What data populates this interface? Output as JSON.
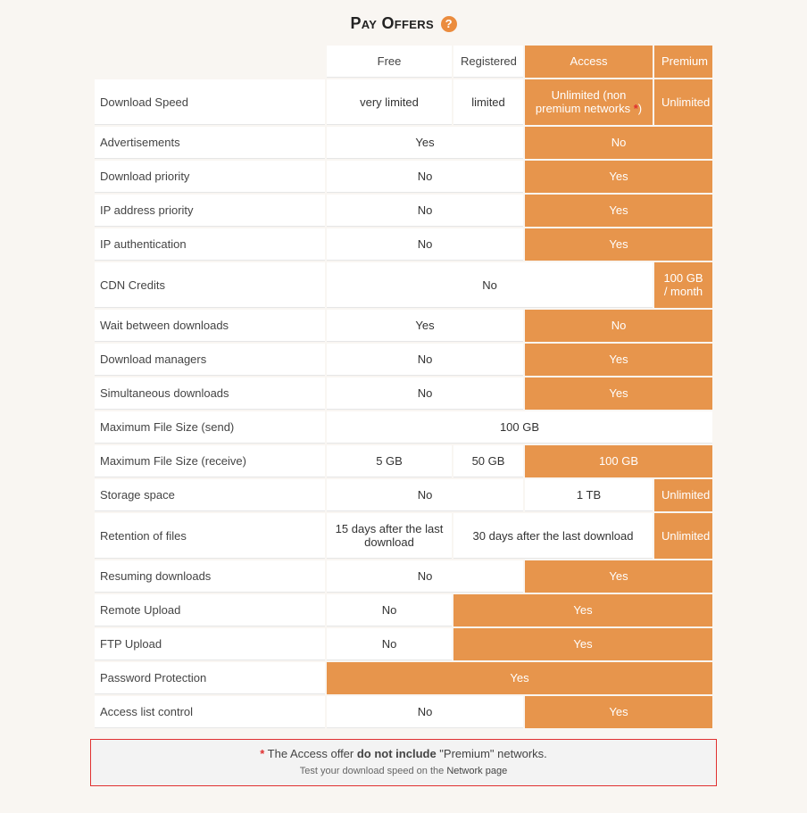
{
  "title": "Pay Offers",
  "help_badge": "?",
  "plans": {
    "free": "Free",
    "registered": "Registered",
    "access": "Access",
    "premium": "Premium"
  },
  "rows": {
    "download_speed": {
      "label": "Download Speed",
      "free": "very limited",
      "registered": "limited",
      "access_prefix": "Unlimited (non premium networks ",
      "access_ast": "*",
      "access_suffix": ")",
      "premium": "Unlimited"
    },
    "ads": {
      "label": "Advertisements",
      "free_reg": "Yes",
      "acc_prem": "No"
    },
    "dlprio": {
      "label": "Download priority",
      "free_reg": "No",
      "acc_prem": "Yes"
    },
    "ipprio": {
      "label": "IP address priority",
      "free_reg": "No",
      "acc_prem": "Yes"
    },
    "ipauth": {
      "label": "IP authentication",
      "free_reg": "No",
      "acc_prem": "Yes"
    },
    "cdn": {
      "label": "CDN Credits",
      "free_reg_acc": "No",
      "premium": "100 GB / month"
    },
    "wait": {
      "label": "Wait between downloads",
      "free_reg": "Yes",
      "acc_prem": "No"
    },
    "dlmgr": {
      "label": "Download managers",
      "free_reg": "No",
      "acc_prem": "Yes"
    },
    "simul": {
      "label": "Simultaneous downloads",
      "free_reg": "No",
      "acc_prem": "Yes"
    },
    "maxsend": {
      "label": "Maximum File Size (send)",
      "all": "100 GB"
    },
    "maxrecv": {
      "label": "Maximum File Size (receive)",
      "free": "5 GB",
      "registered": "50 GB",
      "acc_prem": "100 GB"
    },
    "storage": {
      "label": "Storage space",
      "free_reg": "No",
      "access": "1 TB",
      "premium": "Unlimited"
    },
    "retention": {
      "label": "Retention of files",
      "free": "15 days after the last download",
      "reg_acc": "30 days after the last download",
      "premium": "Unlimited"
    },
    "resume": {
      "label": "Resuming downloads",
      "free_reg": "No",
      "acc_prem": "Yes"
    },
    "remoteup": {
      "label": "Remote Upload",
      "free": "No",
      "reg_acc_prem": "Yes"
    },
    "ftpup": {
      "label": "FTP Upload",
      "free": "No",
      "reg_acc_prem": "Yes"
    },
    "password": {
      "label": "Password Protection",
      "all_hot": "Yes"
    },
    "acl": {
      "label": "Access list control",
      "free_reg": "No",
      "acc_prem": "Yes"
    }
  },
  "footnote": {
    "ast": "*",
    "pre": " The Access offer ",
    "bold": "do not include",
    "post": " \"Premium\" networks.",
    "test_pre": "Test your download speed on the ",
    "test_link": "Network page"
  }
}
